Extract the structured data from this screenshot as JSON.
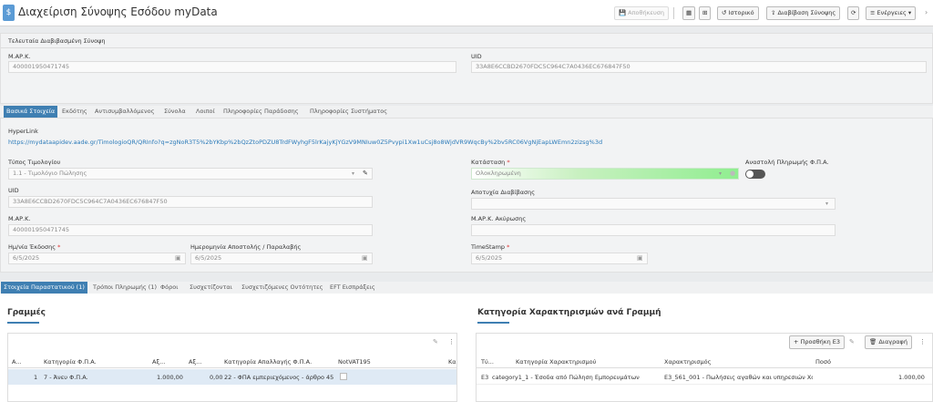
{
  "header": {
    "title": "Διαχείριση Σύνοψης Εσόδου myData",
    "buttons": {
      "save": "Αποθήκευση",
      "history": "Ιστορικό",
      "read_summary": "Διαβίβαση Σύνοψης",
      "actions": "Ενέργειες"
    }
  },
  "last_sent": {
    "section_title": "Τελευταία Διαβιβασμένη Σύνοψη",
    "mark_label": "Μ.ΑΡ.Κ.",
    "mark_value": "400001950471745",
    "uid_label": "UID",
    "uid_value": "33A8E6CCBD2670FDC5C964C7A0436EC676847F50"
  },
  "main_tabs": [
    "Βασικά Στοιχεία",
    "Εκδότης",
    "Αντισυμβαλλόμενος",
    "Σύνολα",
    "Λοιποί",
    "Πληροφορίες Παράδοσης",
    "Πληροφορίες Συστήματος"
  ],
  "basic": {
    "hyperlink_label": "HyperLink",
    "hyperlink_value": "https://mydataapidev.aade.gr/TimologioQR/QRInfo?q=zgNoR3T5%2bYKbp%2bQzZtoPDZU8TrdFWyhgF5lrKajyKjYGzV9MNIuw0Z5Pvypi1Xw1uCsj8o8WjdVR9WqcBy%2bv5RC06VgNjEapLWEmn2zizsg%3d",
    "doc_type_label": "Τύπος Τιμολογίου",
    "doc_type_value": "1.1 - Τιμολόγιο Πώλησης",
    "status_label": "Κατάσταση",
    "status_value": "Ολοκληρωμένη",
    "vat_suspend_label": "Αναστολή Πληρωμής Φ.Π.Α.",
    "uid_label": "UID",
    "uid_value": "33A8E6CCBD2670FDC5C964C7A0436EC676847F50",
    "fail_label": "Αποτυχία Διαβίβασης",
    "mark_label": "Μ.ΑΡ.Κ.",
    "mark_value": "400001950471745",
    "cancel_mark_label": "Μ.ΑΡ.Κ. Ακύρωσης",
    "issue_date_label": "Ημ/νία Έκδοσης",
    "issue_date_value": "6/5/2025",
    "dispatch_date_label": "Ημερομηνία Αποστολής / Παραλαβής",
    "dispatch_date_value": "6/5/2025",
    "timestamp_label": "TimeStamp",
    "timestamp_value": "6/5/2025",
    "req_mark": "*"
  },
  "detail_tabs": [
    "Στοιχεία Παραστατικού (1)",
    "Τρόποι Πληρωμής (1)",
    "Φόροι",
    "Συσχετίζονται",
    "Συσχετιζόμενες Οντότητες",
    "EFT Εισπράξεις"
  ],
  "lines": {
    "title": "Γραμμές",
    "columns": [
      "Α...",
      "Κατηγορία Φ.Π.Α.",
      "Αξ...",
      "Αξ...",
      "Κατηγορία Απαλλαγής Φ.Π.Α.",
      "NotVAT195",
      "Κα"
    ],
    "rows": [
      {
        "a": "1",
        "vat_cat": "7 - Άνευ Φ.Π.Α.",
        "net": "1.000,00",
        "vat": "0,00",
        "exempt": "22 - ΦΠΑ εμπεριεχόμενος - άρθρο 45"
      }
    ]
  },
  "classifications": {
    "title": "Κατηγορία Χαρακτηρισμών ανά Γραμμή",
    "add_button": "Προσθήκη E3",
    "delete_button": "Διαγραφή",
    "columns": [
      "Τύ...",
      "Κατηγορία Χαρακτηρισμού",
      "Χαρακτηρισμός",
      "Ποσό"
    ],
    "rows": [
      {
        "type": "E3",
        "category": "category1_1 - Έσοδα από Πώληση Εμπορευμάτων",
        "classification": "E3_561_001 - Πωλήσεις αγαθών και υπηρεσιών Χο",
        "amount": "1.000,00"
      }
    ]
  },
  "colors": {
    "accent": "#3f7fb2",
    "link": "#2a7ab9",
    "status_green": "#90ee90"
  }
}
